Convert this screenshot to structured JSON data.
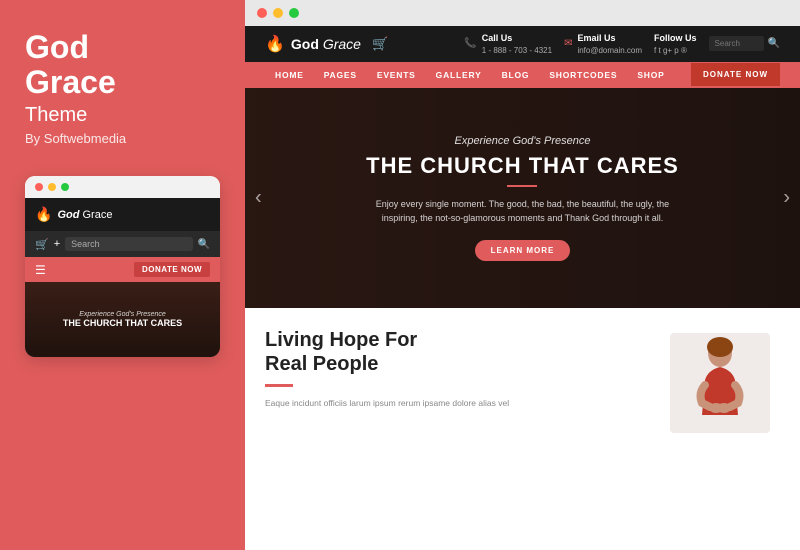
{
  "left": {
    "title_line1": "God",
    "title_line2": "Grace",
    "subtitle": "Theme",
    "by": "By Softwebmedia"
  },
  "mobile": {
    "logo_god": "God",
    "logo_grace": "Grace",
    "search_placeholder": "Search",
    "donate_label": "DONATE NOW",
    "hero_sub": "Experience God's Presence",
    "hero_title": "THE CHURCH THAT CARES"
  },
  "site": {
    "logo_god": "God",
    "logo_grace": "Grace",
    "call_label": "Call Us",
    "call_number": "1 - 888 - 703 - 4321",
    "email_label": "Email Us",
    "email_value": "info@domain.com",
    "follow_label": "Follow Us",
    "search_placeholder": "Search",
    "nav": [
      "HOME",
      "PAGES",
      "EVENTS",
      "GALLERY",
      "BLOG",
      "SHORTCODES",
      "SHOP"
    ],
    "donate_label": "DONATE NOW",
    "hero_sub": "Experience God's Presence",
    "hero_title": "THE CHURCH THAT CARES",
    "hero_text": "Enjoy every single moment. The good, the bad, the beautiful, the ugly, the inspiring, the not-so-glamorous moments and Thank God through it all.",
    "hero_btn": "LEARN MORE",
    "below_title_line1": "Living Hope For",
    "below_title_line2": "Real People",
    "below_text": "Eaque incidunt officiis larum ipsum rerum ipsame dolore alias vel"
  },
  "browser": {
    "dots": [
      "red",
      "yellow",
      "green"
    ]
  }
}
